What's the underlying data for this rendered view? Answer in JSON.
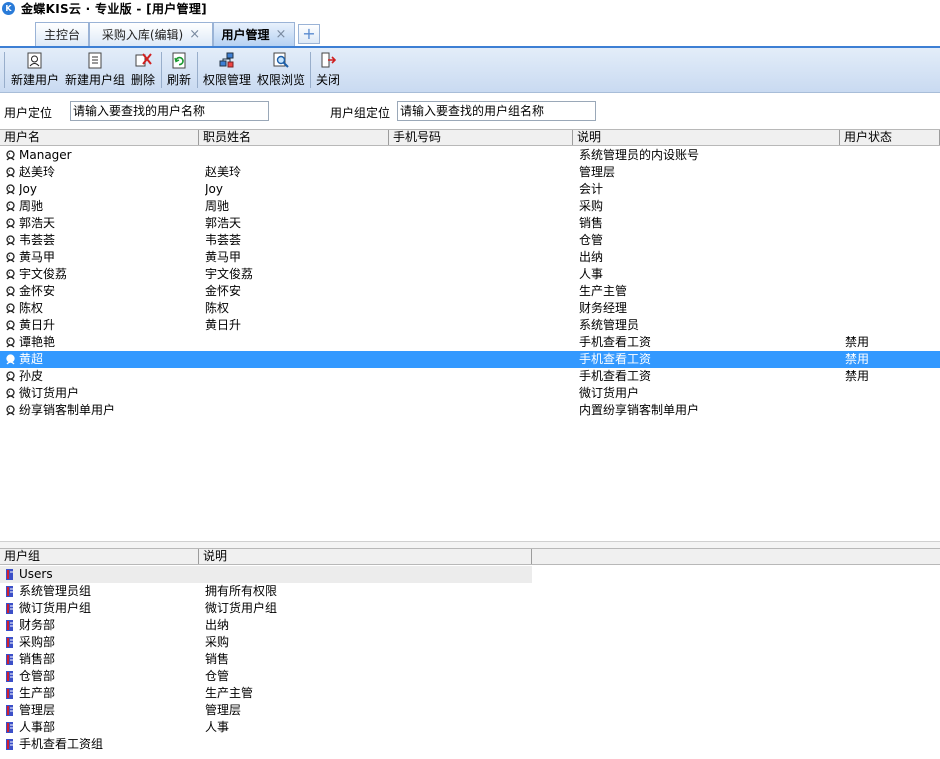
{
  "window": {
    "title": "金蝶KIS云 · 专业版 - [用户管理]"
  },
  "tabs": [
    {
      "label": "主控台",
      "closable": false,
      "active": false
    },
    {
      "label": "采购入库(编辑)",
      "closable": true,
      "active": false
    },
    {
      "label": "用户管理",
      "closable": true,
      "active": true
    }
  ],
  "tab_close_glyph": "×",
  "tab_add_glyph": "+",
  "toolbar": {
    "new_user": "新建用户",
    "new_group": "新建用户组",
    "delete": "删除",
    "refresh": "刷新",
    "perm_manage": "权限管理",
    "perm_browse": "权限浏览",
    "close": "关闭"
  },
  "search": {
    "user_label": "用户定位",
    "user_placeholder": "请输入要查找的用户名称",
    "group_label": "用户组定位",
    "group_placeholder": "请输入要查找的用户组名称"
  },
  "users_table": {
    "headers": [
      "用户名",
      "职员姓名",
      "手机号码",
      "说明",
      "用户状态"
    ],
    "rows": [
      {
        "name": "Manager",
        "staff": "",
        "phone": "",
        "desc": "系统管理员的内设账号",
        "status": "",
        "selected": false
      },
      {
        "name": "赵美玲",
        "staff": "赵美玲",
        "phone": "",
        "desc": "管理层",
        "status": "",
        "selected": false
      },
      {
        "name": "Joy",
        "staff": "Joy",
        "phone": "",
        "desc": "会计",
        "status": "",
        "selected": false
      },
      {
        "name": "周驰",
        "staff": "周驰",
        "phone": "",
        "desc": "采购",
        "status": "",
        "selected": false
      },
      {
        "name": "郭浩天",
        "staff": "郭浩天",
        "phone": "",
        "desc": "销售",
        "status": "",
        "selected": false
      },
      {
        "name": "韦荟荟",
        "staff": "韦荟荟",
        "phone": "",
        "desc": "仓管",
        "status": "",
        "selected": false
      },
      {
        "name": "黄马甲",
        "staff": "黄马甲",
        "phone": "",
        "desc": "出纳",
        "status": "",
        "selected": false
      },
      {
        "name": "宇文俊荔",
        "staff": "宇文俊荔",
        "phone": "",
        "desc": "人事",
        "status": "",
        "selected": false
      },
      {
        "name": "金怀安",
        "staff": "金怀安",
        "phone": "",
        "desc": "生产主管",
        "status": "",
        "selected": false
      },
      {
        "name": "陈权",
        "staff": "陈权",
        "phone": "",
        "desc": "财务经理",
        "status": "",
        "selected": false
      },
      {
        "name": "黄日升",
        "staff": "黄日升",
        "phone": "",
        "desc": "系统管理员",
        "status": "",
        "selected": false
      },
      {
        "name": "谭艳艳",
        "staff": "",
        "phone": "",
        "desc": "手机查看工资",
        "status": "禁用",
        "selected": false
      },
      {
        "name": "黄超",
        "staff": "",
        "phone": "",
        "desc": "手机查看工资",
        "status": "禁用",
        "selected": true
      },
      {
        "name": "孙皮",
        "staff": "",
        "phone": "",
        "desc": "手机查看工资",
        "status": "禁用",
        "selected": false
      },
      {
        "name": "微订货用户",
        "staff": "",
        "phone": "",
        "desc": "微订货用户",
        "status": "",
        "selected": false
      },
      {
        "name": "纷享销客制单用户",
        "staff": "",
        "phone": "",
        "desc": "内置纷享销客制单用户",
        "status": "",
        "selected": false
      }
    ]
  },
  "groups_table": {
    "headers": [
      "用户组",
      "说明"
    ],
    "root": "Users",
    "rows": [
      {
        "name": "系统管理员组",
        "desc": "拥有所有权限"
      },
      {
        "name": "微订货用户组",
        "desc": "微订货用户组"
      },
      {
        "name": "财务部",
        "desc": "出纳"
      },
      {
        "name": "采购部",
        "desc": "采购"
      },
      {
        "name": "销售部",
        "desc": "销售"
      },
      {
        "name": "仓管部",
        "desc": "仓管"
      },
      {
        "name": "生产部",
        "desc": "生产主管"
      },
      {
        "name": "管理层",
        "desc": "管理层"
      },
      {
        "name": "人事部",
        "desc": "人事"
      },
      {
        "name": "手机查看工资组",
        "desc": ""
      }
    ]
  },
  "colors": {
    "selection": "#3399ff",
    "accent": "#3d7fd4",
    "toolbar": "#c9daf1"
  },
  "icons": {
    "app": "kis-cloud-logo-icon",
    "user": "user-head-icon",
    "group": "group-book-icon",
    "new_user": "new-user-icon",
    "new_group": "new-group-icon",
    "delete": "delete-icon",
    "refresh": "refresh-icon",
    "perm_manage": "permission-manage-icon",
    "perm_browse": "permission-browse-icon",
    "close": "exit-icon"
  }
}
